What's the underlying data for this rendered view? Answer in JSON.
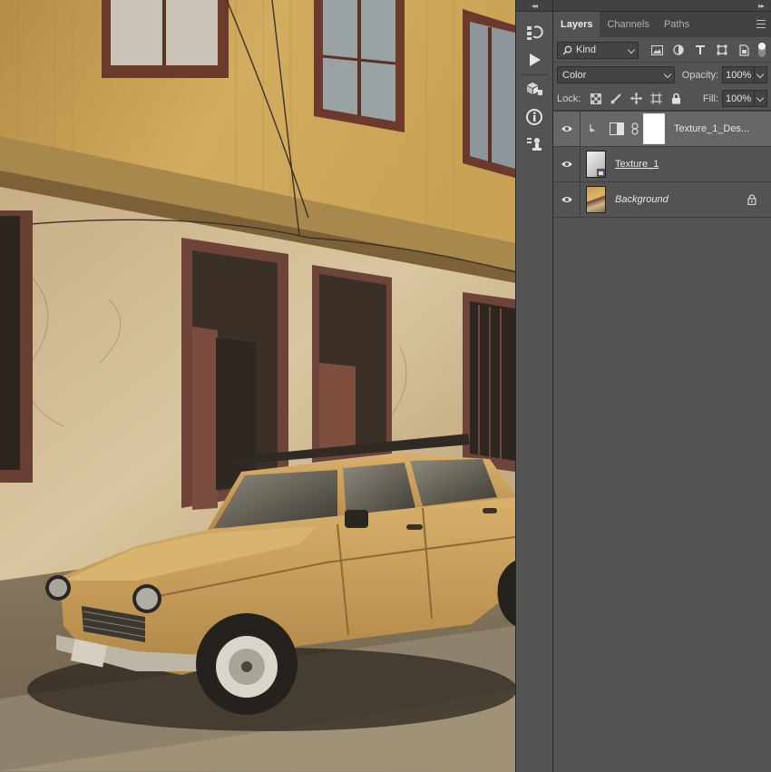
{
  "panel": {
    "tabs": [
      {
        "label": "Layers",
        "active": true
      },
      {
        "label": "Channels",
        "active": false
      },
      {
        "label": "Paths",
        "active": false
      }
    ],
    "filter": {
      "kind_label": "Kind",
      "icons": [
        "image-filter-icon",
        "adjustment-filter-icon",
        "type-filter-icon",
        "shape-filter-icon",
        "smart-object-filter-icon"
      ]
    },
    "blend_mode": "Color",
    "opacity_label": "Opacity:",
    "opacity_value": "100%",
    "lock_label": "Lock:",
    "fill_label": "Fill:",
    "fill_value": "100%",
    "layers": [
      {
        "name": "Texture_1_Des...",
        "visible": true,
        "selected": true,
        "clipped": true,
        "type": "adjustment"
      },
      {
        "name": "Texture_1",
        "visible": true,
        "selected": false,
        "type": "smart-object"
      },
      {
        "name": "Background",
        "visible": true,
        "selected": false,
        "locked": true,
        "type": "image"
      }
    ]
  },
  "toolstrip": {
    "icons": [
      "history-icon",
      "actions-play-icon",
      "3d-icon",
      "info-icon",
      "clone-source-icon"
    ]
  },
  "colors": {
    "panel_bg": "#535353",
    "tab_bar": "#424242",
    "selected_layer": "#676767",
    "wall_yellow": "#c9a25a",
    "car_yellow": "#c9a15c"
  }
}
